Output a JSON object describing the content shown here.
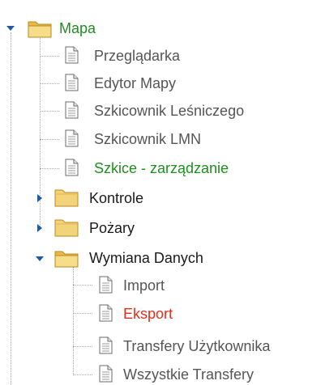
{
  "tree": {
    "root": {
      "label": "Mapa",
      "icon": "folder-open-icon",
      "expanded": true,
      "children": [
        {
          "label": "Przeglądarka",
          "icon": "document-icon"
        },
        {
          "label": "Edytor Mapy",
          "icon": "document-icon"
        },
        {
          "label": "Szkicownik Leśniczego",
          "icon": "document-icon"
        },
        {
          "label": "Szkicownik LMN",
          "icon": "document-icon"
        },
        {
          "label": "Szkice - zarządzanie",
          "icon": "document-icon",
          "highlight": "green"
        }
      ]
    },
    "folders": [
      {
        "label": "Kontrole",
        "icon": "folder-closed-icon",
        "expanded": false
      },
      {
        "label": "Pożary",
        "icon": "folder-closed-icon",
        "expanded": false
      },
      {
        "label": "Wymiana Danych",
        "icon": "folder-open-icon",
        "expanded": true,
        "children": [
          {
            "label": "Import",
            "icon": "document-icon"
          },
          {
            "label": "Eksport",
            "icon": "document-icon",
            "highlight": "red"
          },
          {
            "label": "Transfery Użytkownika",
            "icon": "document-icon"
          },
          {
            "label": "Wszystkie Transfery",
            "icon": "document-icon"
          }
        ]
      }
    ]
  },
  "colors": {
    "green_highlight": "#1e8f1e",
    "red_highlight": "#e0301e",
    "default_leaf_text": "#555555",
    "folder_text": "#1a1a1a",
    "folder_fill": "#f3d37a",
    "tree_lines": "#a8a8a8"
  }
}
